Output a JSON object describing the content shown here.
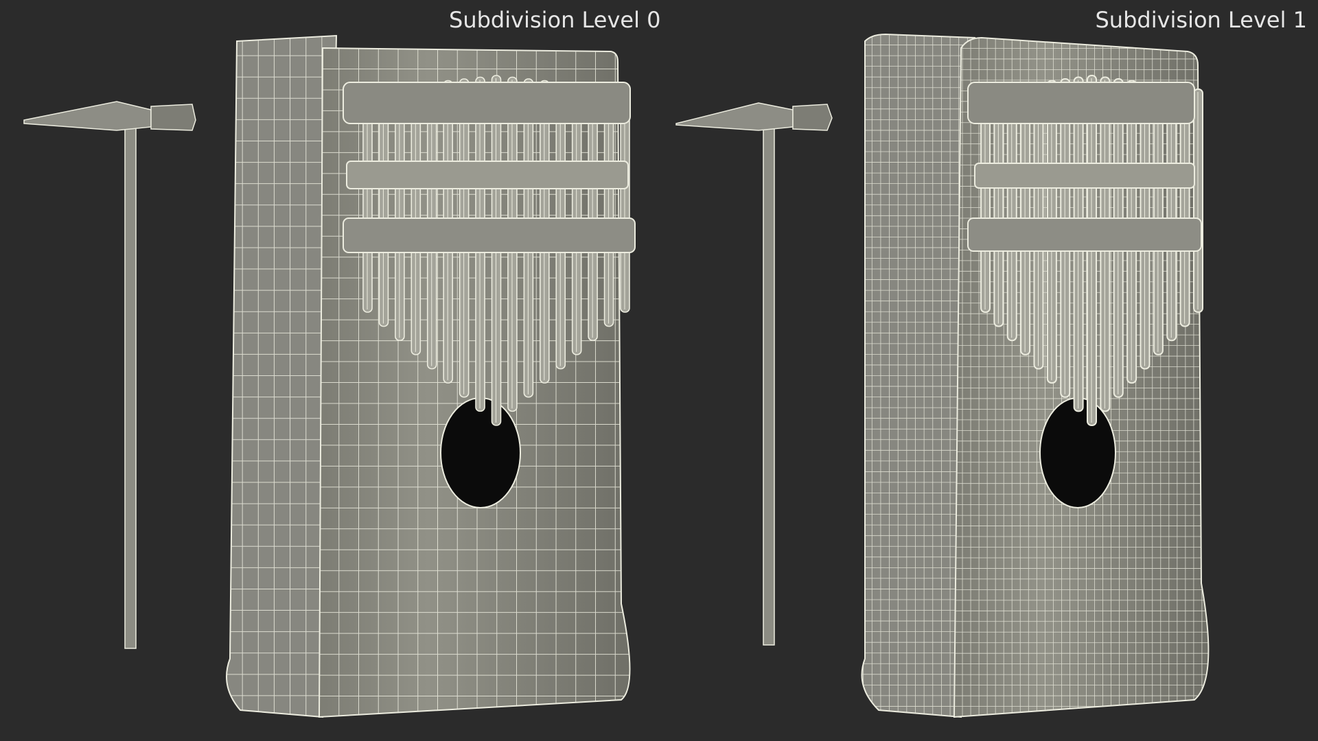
{
  "panels": [
    {
      "caption": "Subdivision Level 0"
    },
    {
      "caption": "Subdivision Level 1"
    }
  ],
  "subjects": {
    "object": "kalimba-wireframe",
    "tool": "tuning-hammer-wireframe"
  },
  "colors": {
    "background": "#2b2b2b",
    "body_shade": "#8e8e84",
    "body_shade_dark": "#6f6f67",
    "wire": "#ececdf",
    "sound_hole": "#0b0b0b",
    "caption_text": "#e6e6e6"
  },
  "grid_density": [
    10,
    20
  ],
  "tine_count": 17
}
